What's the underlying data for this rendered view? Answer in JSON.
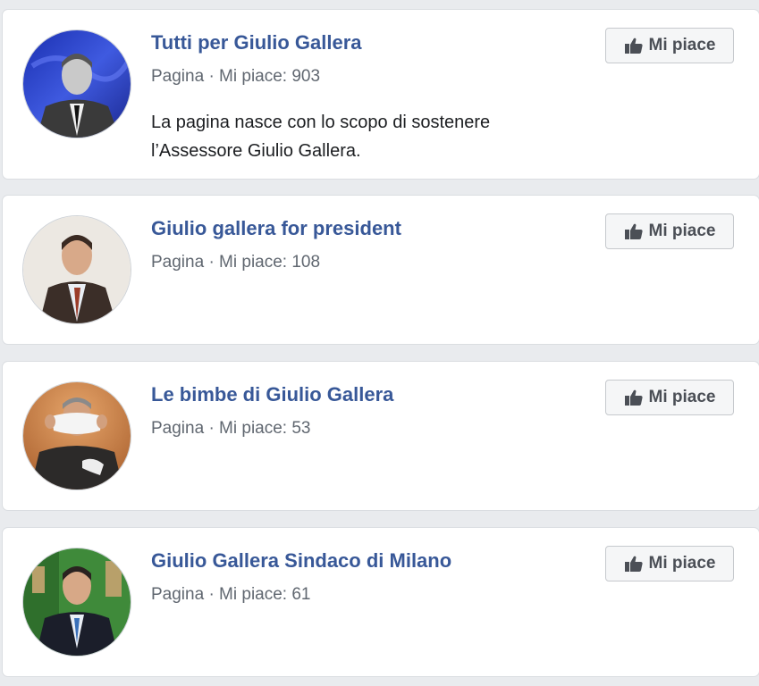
{
  "pages": [
    {
      "title": "Tutti per Giulio Gallera",
      "meta": "Pagina · Mi piace: 903",
      "description_line1": "La pagina nasce con lo scopo di sostenere",
      "description_line2": "l’Assessore Giulio Gallera.",
      "like_label": "Mi piace",
      "avatar_bg": "#2a3fbf"
    },
    {
      "title": "Giulio gallera for president",
      "meta": "Pagina · Mi piace: 108",
      "like_label": "Mi piace",
      "avatar_bg": "#e8e4de"
    },
    {
      "title": "Le bimbe di Giulio Gallera",
      "meta": "Pagina · Mi piace: 53",
      "like_label": "Mi piace",
      "avatar_bg": "#c9824a"
    },
    {
      "title": "Giulio Gallera Sindaco di Milano",
      "meta": "Pagina · Mi piace: 61",
      "like_label": "Mi piace",
      "avatar_bg": "#3f8a3a"
    }
  ],
  "icons": {
    "like_button_icon": "thumbs-up-icon"
  },
  "colors": {
    "title_link": "#385898",
    "meta_text": "#606770",
    "background": "#e9ebee"
  }
}
